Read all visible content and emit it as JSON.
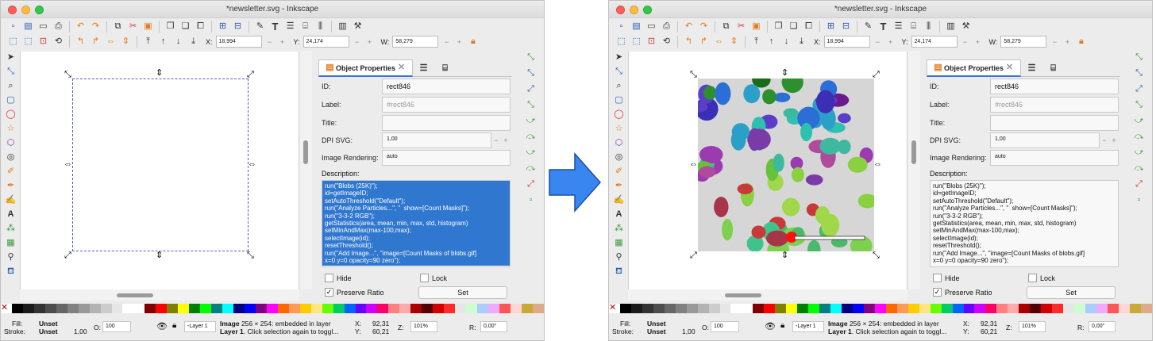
{
  "window_title": "*newsletter.svg - Inkscape",
  "toolbar": {
    "x_label": "X:",
    "x_value": "18,994",
    "y_label": "Y:",
    "y_value": "24,174",
    "w_label": "W:",
    "w_value": "58,279"
  },
  "panel": {
    "tab_object_properties": "Object Properties",
    "id_label": "ID:",
    "id_value": "rect846",
    "label_label": "Label:",
    "label_value": "#rect846",
    "title_label": "Title:",
    "title_value": "",
    "dpi_label": "DPI SVG:",
    "dpi_value": "1,00",
    "rendering_label": "Image Rendering:",
    "rendering_value": "auto",
    "description_label": "Description:",
    "description": "run(\"Blobs (25K)\");\nid=getImageID;\nsetAutoThreshold(\"Default\");\nrun(\"Analyze Particles...\", \"  show=[Count Masks]\");\nrun(\"3-3-2 RGB\");\ngetStatistics(area, mean, min, max, std, histogram)\nsetMinAndMax(max-100,max);\nselectImage(id);\nresetThreshold();\nrun(\"Add Image...\", \"image=[Count Masks of blobs.gif]\nx=0 y=0 opacity=90 zero\");",
    "hide_label": "Hide",
    "lock_label": "Lock",
    "preserve_ratio_label": "Preserve Ratio",
    "set_button": "Set"
  },
  "status": {
    "fill_label": "Fill:",
    "fill_value": "Unset",
    "stroke_label": "Stroke:",
    "stroke_value": "Unset",
    "stroke_width": "1,00",
    "opacity_label": "O:",
    "opacity_value": "100",
    "layer_value": "-Layer 1",
    "message_line1_bold": "Image",
    "message_line1": " 256 × 254: embedded in layer",
    "message_line2_bold": "Layer 1",
    "message_line2": ". Click selection again to toggl...",
    "coord_x_label": "X:",
    "coord_x": "92,31",
    "coord_y_label": "Y:",
    "coord_y": "60,21",
    "zoom_label": "Z:",
    "zoom_value": "101%",
    "rotation_label": "R:",
    "rotation_value": "0,00°"
  },
  "colors": {
    "accent": "#3077cf",
    "arrow": "#3a86f0",
    "selection_dash": "#5a5ac8"
  }
}
